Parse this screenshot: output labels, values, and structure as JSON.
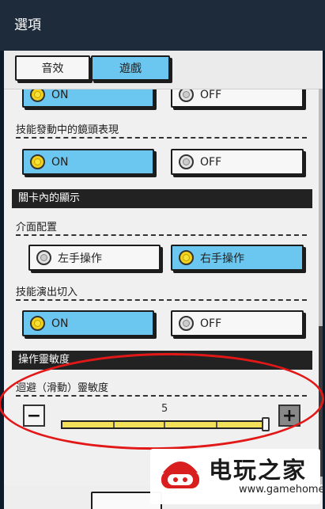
{
  "header": {
    "title": "選項"
  },
  "tabs": [
    {
      "label": "音效",
      "selected": false
    },
    {
      "label": "遊戲",
      "selected": true
    }
  ],
  "settings": {
    "row0": {
      "on_label": "ON",
      "off_label": "OFF",
      "selected": "ON"
    },
    "camera": {
      "label": "技能發動中的鏡頭表現",
      "on_label": "ON",
      "off_label": "OFF",
      "selected": "ON"
    },
    "in_stage_section": "關卡內的顯示",
    "layout": {
      "label": "介面配置",
      "left_label": "左手操作",
      "right_label": "右手操作",
      "selected": "右手操作"
    },
    "cutin": {
      "label": "技能演出切入",
      "on_label": "ON",
      "off_label": "OFF",
      "selected": "ON"
    },
    "sensitivity_section": "操作靈敏度",
    "dodge": {
      "label": "迴避（滑動）靈敏度",
      "value": "5",
      "min": 1,
      "max": 5,
      "minus_label": "−",
      "plus_label": "+"
    }
  },
  "watermark": {
    "title": "电玩之家",
    "url": "www.gamehome.tv"
  },
  "colors": {
    "accent": "#6bc7ef",
    "header": "#1e2b3b",
    "annotation": "#e21818"
  }
}
